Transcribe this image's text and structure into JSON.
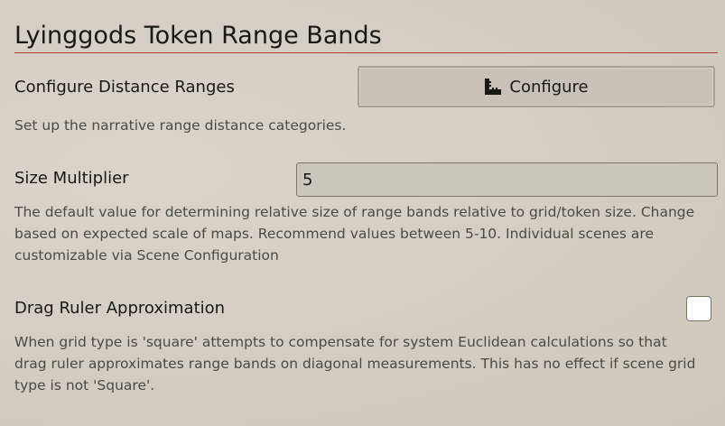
{
  "section": {
    "title": "Lyinggods Token Range Bands"
  },
  "settings": {
    "distance_ranges": {
      "label": "Configure Distance Ranges",
      "button_label": "Configure",
      "button_icon": "ruler-icon",
      "hint": "Set up the narrative range distance categories."
    },
    "size_multiplier": {
      "label": "Size Multiplier",
      "value": "5",
      "hint_lines": [
        "The default value for determining relative size of range bands relative to grid/token size. Change",
        "based on expected scale of maps. Recommend values between 5-10. Individual scenes are",
        "customizable via Scene Configuration"
      ]
    },
    "drag_ruler": {
      "label": "Drag Ruler Approximation",
      "checked": false,
      "hint_lines": [
        "When grid type is 'square' attempts to compensate for system Euclidean calculations so that",
        "drag ruler approximates range bands on diagonal measurements. This has no effect if scene grid",
        "type is not 'Square'."
      ]
    }
  },
  "colors": {
    "accent_rule": "#a6413a",
    "text": "#191813",
    "hint_text": "#4b4a44"
  }
}
